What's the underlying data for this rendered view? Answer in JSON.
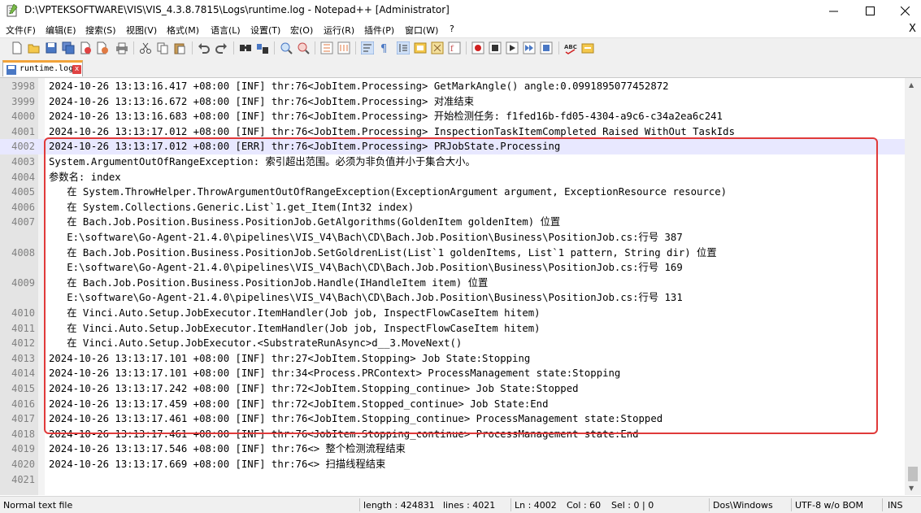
{
  "window": {
    "title": "D:\\VPTEKSOFTWARE\\VIS\\VIS_4.3.8.7815\\Logs\\runtime.log - Notepad++ [Administrator]",
    "minimize": "—",
    "maximize": "☐",
    "close": "✕"
  },
  "menu": {
    "items": [
      "文件(F)",
      "编辑(E)",
      "搜索(S)",
      "视图(V)",
      "格式(M)",
      "语言(L)",
      "设置(T)",
      "宏(O)",
      "运行(R)",
      "插件(P)",
      "窗口(W)",
      "?"
    ],
    "close_doc": "X"
  },
  "toolbar": {
    "icons": [
      "new-file-icon",
      "open-file-icon",
      "save-icon",
      "save-all-icon",
      "close-icon",
      "close-all-icon",
      "print-icon",
      "cut-icon",
      "copy-icon",
      "paste-icon",
      "undo-icon",
      "redo-icon",
      "find-icon",
      "replace-icon",
      "zoom-in-icon",
      "zoom-out-icon",
      "sync-v-icon",
      "sync-h-icon",
      "word-wrap-icon",
      "show-all-chars-icon",
      "indent-guide-icon",
      "udl-icon",
      "doc-map-icon",
      "function-list-icon",
      "folder-workspace-icon",
      "record-macro-icon",
      "stop-record-icon",
      "play-macro-icon",
      "run-macro-multiple-icon",
      "save-macro-icon",
      "spellcheck-icon",
      "spellcheck-options-icon"
    ]
  },
  "tab": {
    "label": "runtime.log",
    "close": "x"
  },
  "editor": {
    "lines": [
      {
        "n": "3998",
        "text": "2024-10-26 13:13:16.417 +08:00 [INF] thr:76<JobItem.Processing> GetMarkAngle() angle:0.0991895077452872"
      },
      {
        "n": "3999",
        "text": "2024-10-26 13:13:16.672 +08:00 [INF] thr:76<JobItem.Processing> 对准结束"
      },
      {
        "n": "4000",
        "text": "2024-10-26 13:13:16.683 +08:00 [INF] thr:76<JobItem.Processing> 开始检测任务: f1fed16b-fd05-4304-a9c6-c34a2ea6c241"
      },
      {
        "n": "4001",
        "text": "2024-10-26 13:13:17.012 +08:00 [INF] thr:76<JobItem.Processing> InspectionTaskItemCompleted Raised WithOut TaskIds"
      },
      {
        "n": "4002",
        "text": "2024-10-26 13:13:17.012 +08:00 [ERR] thr:76<JobItem.Processing> PRJobState.Processing"
      },
      {
        "n": "4003",
        "text": "System.ArgumentOutOfRangeException: 索引超出范围。必须为非负值并小于集合大小。"
      },
      {
        "n": "4004",
        "text": "参数名: index"
      },
      {
        "n": "4005",
        "text": "   在 System.ThrowHelper.ThrowArgumentOutOfRangeException(ExceptionArgument argument, ExceptionResource resource)"
      },
      {
        "n": "4006",
        "text": "   在 System.Collections.Generic.List`1.get_Item(Int32 index)"
      },
      {
        "n": "4007",
        "text": "   在 Bach.Job.Position.Business.PositionJob.GetAlgorithms(GoldenItem goldenItem) 位置"
      },
      {
        "n": "",
        "text": "   E:\\software\\Go-Agent-21.4.0\\pipelines\\VIS_V4\\Bach\\CD\\Bach.Job.Position\\Business\\PositionJob.cs:行号 387"
      },
      {
        "n": "4008",
        "text": "   在 Bach.Job.Position.Business.PositionJob.SetGoldrenList(List`1 goldenItems, List`1 pattern, String dir) 位置"
      },
      {
        "n": "",
        "text": "   E:\\software\\Go-Agent-21.4.0\\pipelines\\VIS_V4\\Bach\\CD\\Bach.Job.Position\\Business\\PositionJob.cs:行号 169"
      },
      {
        "n": "4009",
        "text": "   在 Bach.Job.Position.Business.PositionJob.Handle(IHandleItem item) 位置"
      },
      {
        "n": "",
        "text": "   E:\\software\\Go-Agent-21.4.0\\pipelines\\VIS_V4\\Bach\\CD\\Bach.Job.Position\\Business\\PositionJob.cs:行号 131"
      },
      {
        "n": "4010",
        "text": "   在 Vinci.Auto.Setup.JobExecutor.ItemHandler(Job job, InspectFlowCaseItem hitem)"
      },
      {
        "n": "4011",
        "text": "   在 Vinci.Auto.Setup.JobExecutor.ItemHandler(Job job, InspectFlowCaseItem hitem)"
      },
      {
        "n": "4012",
        "text": "   在 Vinci.Auto.Setup.JobExecutor.<SubstrateRunAsync>d__3.MoveNext()"
      },
      {
        "n": "4013",
        "text": "2024-10-26 13:13:17.101 +08:00 [INF] thr:27<JobItem.Stopping> Job State:Stopping"
      },
      {
        "n": "4014",
        "text": "2024-10-26 13:13:17.101 +08:00 [INF] thr:34<Process.PRContext> ProcessManagement state:Stopping"
      },
      {
        "n": "4015",
        "text": "2024-10-26 13:13:17.242 +08:00 [INF] thr:72<JobItem.Stopping_continue> Job State:Stopped"
      },
      {
        "n": "4016",
        "text": "2024-10-26 13:13:17.459 +08:00 [INF] thr:72<JobItem.Stopped_continue> Job State:End"
      },
      {
        "n": "4017",
        "text": "2024-10-26 13:13:17.461 +08:00 [INF] thr:76<JobItem.Stopping_continue> ProcessManagement state:Stopped"
      },
      {
        "n": "4018",
        "text": "2024-10-26 13:13:17.461 +08:00 [INF] thr:76<JobItem.Stopping_continue> ProcessManagement state:End"
      },
      {
        "n": "4019",
        "text": "2024-10-26 13:13:17.546 +08:00 [INF] thr:76<> 整个检测流程结束"
      },
      {
        "n": "4020",
        "text": "2024-10-26 13:13:17.669 +08:00 [INF] thr:76<> 扫描线程结束"
      },
      {
        "n": "4021",
        "text": ""
      }
    ],
    "current_line_index": 4
  },
  "statusbar": {
    "file_type": "Normal text file",
    "length": "length : 424831",
    "lines": "lines : 4021",
    "ln": "Ln : 4002",
    "col": "Col : 60",
    "sel": "Sel : 0 | 0",
    "eol": "Dos\\Windows",
    "encoding": "UTF-8 w/o BOM",
    "mode": "INS"
  },
  "colors": {
    "highlight_box": "#e03a3a",
    "current_line": "#e8e8ff",
    "tab_accent": "#f2a33a"
  }
}
